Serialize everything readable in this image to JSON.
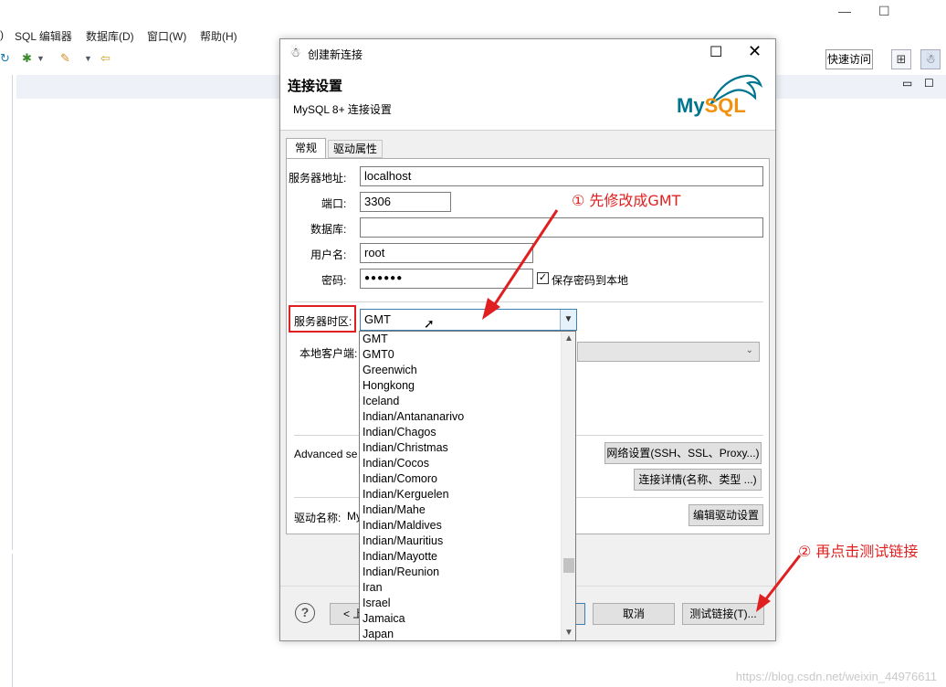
{
  "ide": {
    "menu": [
      ")",
      "SQL 编辑器",
      "数据库(D)",
      "窗口(W)",
      "帮助(H)"
    ],
    "quick_access": "快速访问",
    "window_controls": [
      "—",
      "☐"
    ]
  },
  "dialog": {
    "title": "创建新连接",
    "header_title": "连接设置",
    "header_subtitle": "MySQL 8+ 连接设置",
    "logo_my": "My",
    "logo_sql": "SQL",
    "tabs": [
      "常规",
      "驱动属性"
    ],
    "fields": {
      "host_label": "服务器地址:",
      "host_value": "localhost",
      "port_label": "端口:",
      "port_value": "3306",
      "database_label": "数据库:",
      "database_value": "",
      "user_label": "用户名:",
      "user_value": "root",
      "password_label": "密码:",
      "password_value": "●●●●●●",
      "save_password_label": "保存密码到本地",
      "save_password_checked": true,
      "timezone_label": "服务器时区:",
      "timezone_value": "GMT",
      "client_label": "本地客户端:",
      "advanced_label": "Advanced se",
      "driver_label": "驱动名称:",
      "driver_value": "My"
    },
    "buttons": {
      "network": "网络设置(SSH、SSL、Proxy...)",
      "conn_details": "连接详情(名称、类型 ...)",
      "edit_driver": "编辑驱动设置",
      "back": "< 上",
      "cancel": "取消",
      "test": "测试链接(T)..."
    },
    "timezone_options": [
      "GMT",
      "GMT0",
      "Greenwich",
      "Hongkong",
      "Iceland",
      "Indian/Antananarivo",
      "Indian/Chagos",
      "Indian/Christmas",
      "Indian/Cocos",
      "Indian/Comoro",
      "Indian/Kerguelen",
      "Indian/Mahe",
      "Indian/Maldives",
      "Indian/Mauritius",
      "Indian/Mayotte",
      "Indian/Reunion",
      "Iran",
      "Israel",
      "Jamaica",
      "Japan"
    ]
  },
  "annotations": {
    "step1": "① 先修改成GMT",
    "step2": "② 再点击测试链接",
    "watermark": "https://blog.csdn.net/weixin_44976611"
  },
  "colors": {
    "annotation_red": "#e02020",
    "mysql_blue": "#00758f",
    "mysql_orange": "#f29111"
  }
}
